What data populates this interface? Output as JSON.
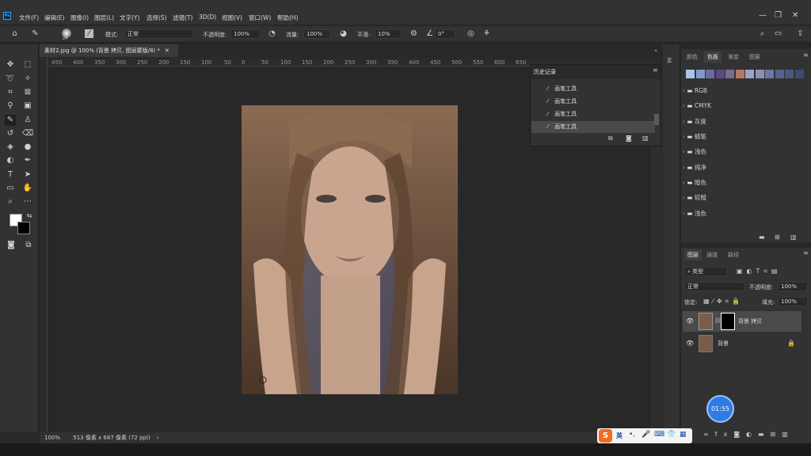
{
  "app": {
    "logo": "Ps"
  },
  "menu": [
    "文件(F)",
    "编辑(E)",
    "图像(I)",
    "图层(L)",
    "文字(Y)",
    "选择(S)",
    "滤镜(T)",
    "3D(D)",
    "视图(V)",
    "窗口(W)",
    "帮助(H)"
  ],
  "options": {
    "brush_size": "24",
    "mode_label": "模式:",
    "mode_value": "正常",
    "opacity_label": "不透明度:",
    "opacity_value": "100%",
    "flow_label": "流量:",
    "flow_value": "100%",
    "smooth_label": "平滑:",
    "smooth_value": "10%",
    "angle_value": "0°"
  },
  "document": {
    "tab_title": "素材2.jpg @ 100% (背景 拷贝, 图层蒙版/8) *",
    "ruler_ticks": [
      "450",
      "400",
      "350",
      "300",
      "250",
      "200",
      "150",
      "100",
      "50",
      "0",
      "50",
      "100",
      "150",
      "200",
      "250",
      "300",
      "350",
      "400",
      "450",
      "500",
      "550",
      "600",
      "650"
    ],
    "zoom": "100%",
    "doc_info": "513 像素 x 687 像素 (72 ppi)"
  },
  "history": {
    "title": "历史记录",
    "items": [
      "画笔工具",
      "画笔工具",
      "画笔工具",
      "画笔工具"
    ]
  },
  "swatches": {
    "tabs": [
      "颜色",
      "色板",
      "渐变",
      "图案"
    ],
    "colors": [
      "#a9c6e8",
      "#7f9ccf",
      "#6e6c9e",
      "#5a4a82",
      "#7b6c8e",
      "#b47a5f",
      "#9aa2c8",
      "#8d8fb8",
      "#6f78a5",
      "#56628e",
      "#4a5880",
      "#3e4b72"
    ],
    "folders": [
      "RGB",
      "CMYK",
      "灰度",
      "蜡笔",
      "浅色",
      "纯净",
      "暗色",
      "较暗",
      "浅色"
    ]
  },
  "layers": {
    "tabs": [
      "图层",
      "通道",
      "路径"
    ],
    "filter_label": "类型",
    "blend_mode": "正常",
    "opacity_label": "不透明度:",
    "opacity_value": "100%",
    "lock_label": "锁定:",
    "fill_label": "填充:",
    "fill_value": "100%",
    "items": [
      {
        "name": "背景 拷贝",
        "selected": true
      },
      {
        "name": "背景",
        "selected": false
      }
    ]
  },
  "overlay": {
    "timer": "01:55",
    "ime_lang": "英"
  }
}
